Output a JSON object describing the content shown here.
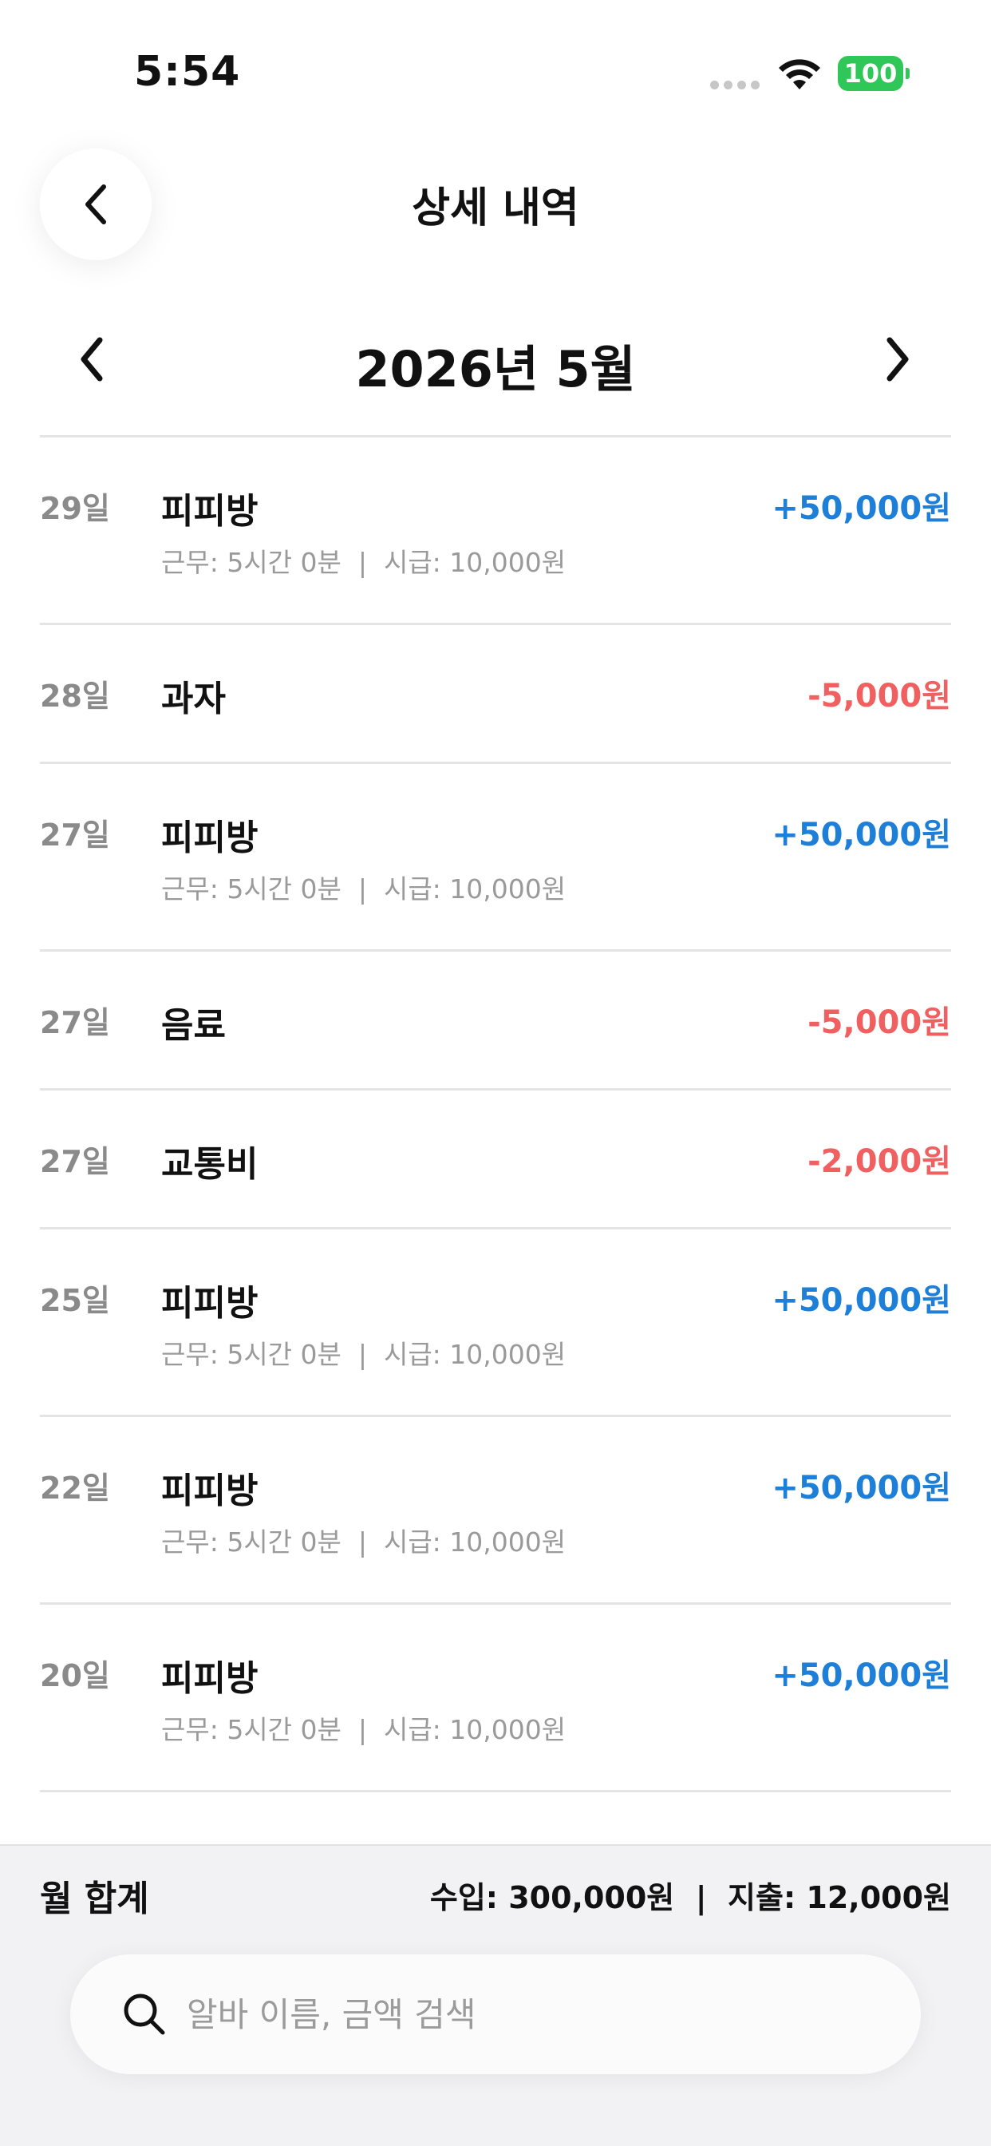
{
  "status_bar": {
    "time": "5:54",
    "battery": "100"
  },
  "header": {
    "title": "상세 내역"
  },
  "month_nav": {
    "label": "2026년 5월"
  },
  "transactions": [
    {
      "day": "29일",
      "name": "피피방",
      "detail": "근무: 5시간 0분  |  시급: 10,000원",
      "amount": "+50,000원",
      "kind": "income"
    },
    {
      "day": "28일",
      "name": "과자",
      "detail": "",
      "amount": "-5,000원",
      "kind": "expense"
    },
    {
      "day": "27일",
      "name": "피피방",
      "detail": "근무: 5시간 0분  |  시급: 10,000원",
      "amount": "+50,000원",
      "kind": "income"
    },
    {
      "day": "27일",
      "name": "음료",
      "detail": "",
      "amount": "-5,000원",
      "kind": "expense"
    },
    {
      "day": "27일",
      "name": "교통비",
      "detail": "",
      "amount": "-2,000원",
      "kind": "expense"
    },
    {
      "day": "25일",
      "name": "피피방",
      "detail": "근무: 5시간 0분  |  시급: 10,000원",
      "amount": "+50,000원",
      "kind": "income"
    },
    {
      "day": "22일",
      "name": "피피방",
      "detail": "근무: 5시간 0분  |  시급: 10,000원",
      "amount": "+50,000원",
      "kind": "income"
    },
    {
      "day": "20일",
      "name": "피피방",
      "detail": "근무: 5시간 0분  |  시급: 10,000원",
      "amount": "+50,000원",
      "kind": "income"
    }
  ],
  "summary": {
    "label": "월 합계",
    "text": "수입: 300,000원  |  지출: 12,000원"
  },
  "search": {
    "placeholder": "알바 이름, 금액 검색",
    "value": ""
  },
  "colors": {
    "income": "#1e7fd9",
    "expense": "#f06060",
    "battery": "#30c759"
  }
}
